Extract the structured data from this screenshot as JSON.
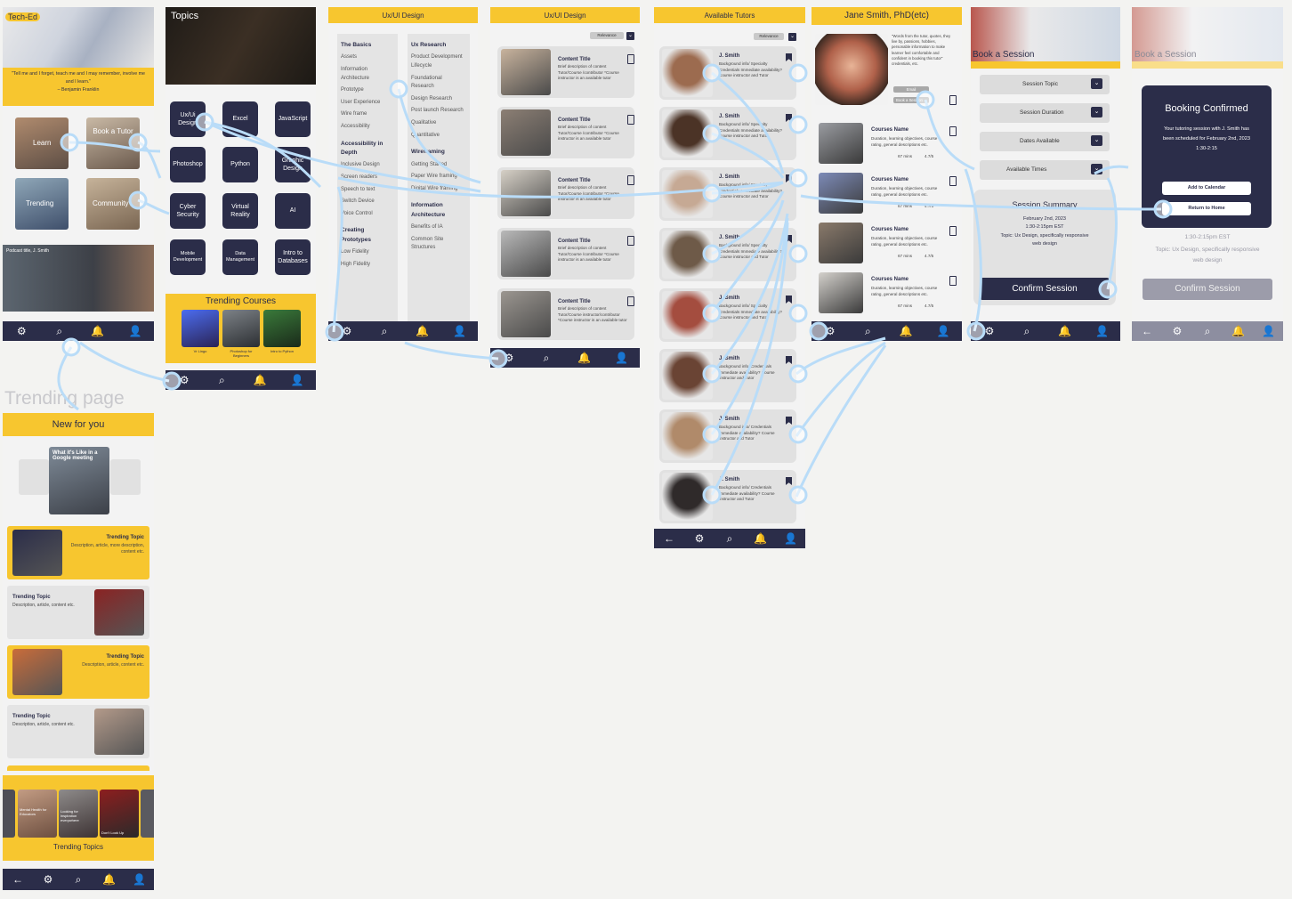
{
  "colors": {
    "accent": "#f7c62f",
    "navy": "#2b2d49",
    "panel": "#f0f0f0",
    "link": "#b9dcf8"
  },
  "icons": [
    "gear-icon",
    "search-icon",
    "bell-icon",
    "user-icon",
    "back-arrow-icon",
    "bookmark-icon",
    "chevron-down-icon"
  ],
  "nav": {
    "gear": "⚙",
    "search": "⌕",
    "bell": "🔔",
    "user": "👤",
    "back": "←"
  },
  "home": {
    "logo": "Tech-Ed",
    "quote": "\"Tell me and I forget, teach me and I may remember, involve me and I learn.\"",
    "quote_author": "– Benjamin Franklin",
    "tiles": [
      "Learn",
      "Book a Tutor",
      "Trending",
      "Community"
    ],
    "podcast": "Podcast title, J. Smith"
  },
  "topics": {
    "title": "Topics",
    "tiles": [
      "Ux/Ui Design",
      "Excel",
      "JavaScript",
      "Photoshop",
      "Python",
      "Graphic Design",
      "Cyber Security",
      "Virtual Reality",
      "AI",
      "Mobile Development",
      "Data Management",
      "Intro to Databases"
    ],
    "trending_title": "Trending Courses",
    "trending": [
      "Vr Lingo",
      "Photoshop for Beginners",
      "Intro to Python"
    ]
  },
  "uxmenu": {
    "title": "Ux/UI Design",
    "left": [
      {
        "h": "The Basics",
        "items": [
          "Assets",
          "Information Architecture",
          "Prototype",
          "User Experience",
          "Wire frame",
          "Accessibility"
        ]
      },
      {
        "h": "Accessibility in Depth",
        "items": [
          "Inclusive Design",
          "Screen readers",
          "Speech to text",
          "Switch Device",
          "Voice Control"
        ]
      },
      {
        "h": "Creating Prototypes",
        "items": [
          "Low Fidelity",
          "High Fidelity"
        ]
      }
    ],
    "right": [
      {
        "h": "Ux Research",
        "items": [
          "Product Development Lifecycle",
          "Foundational Research",
          "Design Research",
          "Post launch Research",
          "Qualitative",
          "Quantitative"
        ]
      },
      {
        "h": "Wireframing",
        "items": [
          "Getting Started",
          "Paper Wire framing",
          "Digital Wire framing"
        ]
      },
      {
        "h": "Information Architecture",
        "items": [
          "Benefits of IA",
          "Common Site Structures"
        ]
      }
    ]
  },
  "content": {
    "title": "Ux/UI Design",
    "relevance": "Relevance",
    "cards": [
      {
        "title": "Content Title",
        "desc": "Brief description of content Tutor/Course /contributor *Course instructor is an available tutor"
      },
      {
        "title": "Content Title",
        "desc": "Brief description of content Tutor/Course /contributor *Course instructor is an available tutor"
      },
      {
        "title": "Content Title",
        "desc": "Brief description of content Tutor/Course /contributor *Course instructor is an available tutor"
      },
      {
        "title": "Content Title",
        "desc": "Brief description of content Tutor/Course /contributor *Course instructor is an available tutor"
      },
      {
        "title": "Content Title",
        "desc": "Brief description of content Tutor/Course instructor/contributor *Course instructor is an available tutor"
      }
    ]
  },
  "tutors": {
    "title": "Available Tutors",
    "relevance": "Relevance",
    "items": [
      {
        "name": "J. Smith",
        "desc": "Background info/ Specialty Credentials Immediate availability? Course instructor and Tutor"
      },
      {
        "name": "J. Smith",
        "desc": "Background info/ Specialty Credentials Immediate availability? Course instructor and Tutor"
      },
      {
        "name": "J. Smith",
        "desc": "Background info/ Specialty Credentials Immediate availability? Course instructor and Tutor"
      },
      {
        "name": "J. Smith",
        "desc": "Background info/ Specialty Credentials Immediate availability? Course instructor and Tutor"
      },
      {
        "name": "J. Smith",
        "desc": "Background info/ Specialty Credentials Immediate availability? Course instructor and Tutor"
      },
      {
        "name": "J. Smith",
        "desc": "Background info/ Credentials Immediate availability? Course instructor and Tutor"
      },
      {
        "name": "J. Smith",
        "desc": "Background info/ Credentials Immediate availability? Course instructor and Tutor"
      },
      {
        "name": "J. Smith",
        "desc": "Background info/ Credentials Immediate availability? Course instructor and Tutor"
      }
    ]
  },
  "profile": {
    "title": "Jane Smith, PhD(etc)",
    "bio": "\"Words from the tutor, quotes, they live by, passions, hobbies, personable information to make learner feel comfortable and confident in booking this tutor\" credentials, etc.",
    "email": "Email",
    "book": "Book a Session",
    "courses": [
      {
        "name": "Courses Name",
        "desc": "Duration, learning objectives, course rating, general descriptions etc.",
        "dur": "67 mins",
        "rating": "4.7/5"
      },
      {
        "name": "Courses Name",
        "desc": "Duration, learning objectives, course rating, general descriptions etc.",
        "dur": "67 mins",
        "rating": "4.7/5"
      },
      {
        "name": "Courses Name",
        "desc": "Duration, learning objectives, course rating, general descriptions etc.",
        "dur": "67 mins",
        "rating": "4.7/5"
      },
      {
        "name": "Courses Name",
        "desc": "Duration, learning objectives, course rating, general descriptions etc.",
        "dur": "67 mins",
        "rating": "4.7/5"
      }
    ]
  },
  "booking": {
    "title": "Book a Session",
    "dropdowns": [
      "Session Topic",
      "Session Duration",
      "Dates Available",
      "Available Times"
    ],
    "summary_title": "Session Summary",
    "summary": [
      "February 2nd, 2023",
      "1:30-2:15pm EST",
      "Topic: Ux Design, specifically responsive web design"
    ],
    "confirm": "Confirm Session"
  },
  "confirmed": {
    "title": "Book a Session",
    "modal_title": "Booking Confirmed",
    "modal_text": "Your tutoring session with J. Smith has been scheduled for February 2nd, 2023 1:30-2:15",
    "add_calendar": "Add to Calendar",
    "return_home": "Return to Home",
    "bg_time": "1:30-2:15pm EST",
    "bg_topic": "Topic: Ux Design, specifically responsive web design",
    "confirm": "Confirm Session"
  },
  "trending": {
    "page_label": "Trending page",
    "header": "New for you",
    "hero": "What it's Like in a Google meeting",
    "cards": [
      {
        "title": "Trending Topic",
        "desc": "Description, article, more description, content etc."
      },
      {
        "title": "Trending Topic",
        "desc": "Description, article, content etc."
      },
      {
        "title": "Trending Topic",
        "desc": "Description, article, content etc."
      },
      {
        "title": "Trending Topic",
        "desc": "Description, article, content etc."
      }
    ],
    "footer_items": [
      "Mental Health for Educators",
      "Looking for inspiration everywhere",
      "Don't Look Up"
    ],
    "footer_title": "Trending Topics"
  }
}
